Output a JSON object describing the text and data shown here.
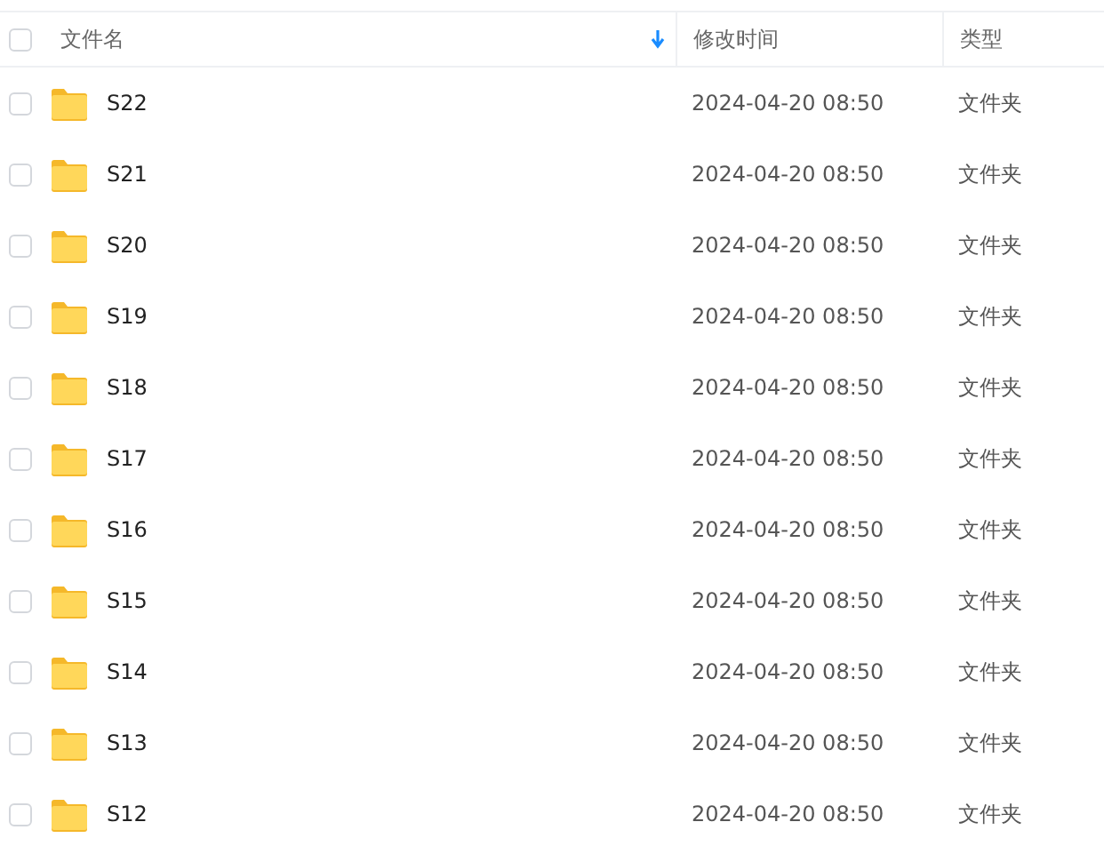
{
  "columns": [
    {
      "label": "文件名",
      "sorted": true
    },
    {
      "label": "修改时间",
      "sorted": false
    },
    {
      "label": "类型",
      "sorted": false
    }
  ],
  "select_all": {
    "checked": false
  },
  "rows": [
    {
      "name": "S22",
      "modified": "2024-04-20 08:50",
      "type": "文件夹",
      "checked": false
    },
    {
      "name": "S21",
      "modified": "2024-04-20 08:50",
      "type": "文件夹",
      "checked": false
    },
    {
      "name": "S20",
      "modified": "2024-04-20 08:50",
      "type": "文件夹",
      "checked": false
    },
    {
      "name": "S19",
      "modified": "2024-04-20 08:50",
      "type": "文件夹",
      "checked": false
    },
    {
      "name": "S18",
      "modified": "2024-04-20 08:50",
      "type": "文件夹",
      "checked": false
    },
    {
      "name": "S17",
      "modified": "2024-04-20 08:50",
      "type": "文件夹",
      "checked": false
    },
    {
      "name": "S16",
      "modified": "2024-04-20 08:50",
      "type": "文件夹",
      "checked": false
    },
    {
      "name": "S15",
      "modified": "2024-04-20 08:50",
      "type": "文件夹",
      "checked": false
    },
    {
      "name": "S14",
      "modified": "2024-04-20 08:50",
      "type": "文件夹",
      "checked": false
    },
    {
      "name": "S13",
      "modified": "2024-04-20 08:50",
      "type": "文件夹",
      "checked": false
    },
    {
      "name": "S12",
      "modified": "2024-04-20 08:50",
      "type": "文件夹",
      "checked": false
    }
  ]
}
